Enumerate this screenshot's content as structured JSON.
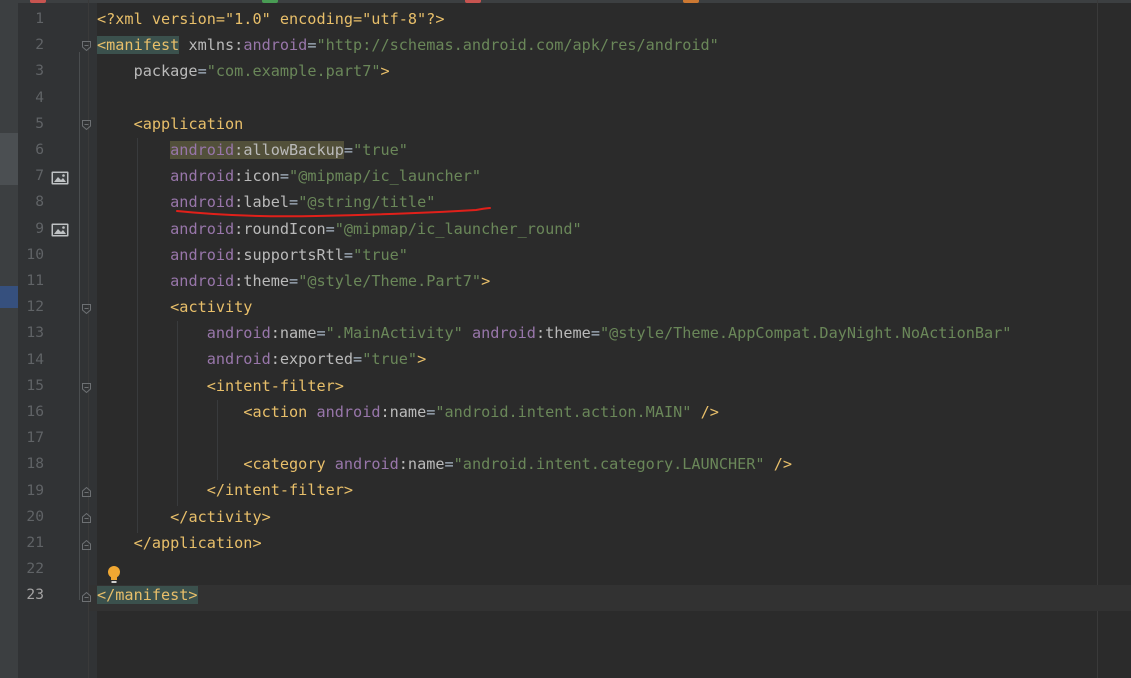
{
  "editor": {
    "file_language": "xml",
    "current_line": 23,
    "lines": [
      {
        "n": "1",
        "segs": [
          {
            "c": "pi",
            "t": "<?xml version=\"1.0\" encoding=\"utf-8\"?>"
          }
        ]
      },
      {
        "n": "2",
        "segs": [
          {
            "c": "tg hl",
            "t": "<manifest"
          },
          {
            "c": "at",
            "t": " xmlns:"
          },
          {
            "c": "ns",
            "t": "android"
          },
          {
            "c": "tx",
            "t": "="
          },
          {
            "c": "val",
            "t": "\"http://schemas.android.com/apk/res/android\""
          }
        ]
      },
      {
        "n": "3",
        "segs": [
          {
            "c": "at",
            "t": "    package"
          },
          {
            "c": "tx",
            "t": "="
          },
          {
            "c": "val",
            "t": "\"com.example.part7\""
          },
          {
            "c": "tg",
            "t": ">"
          }
        ]
      },
      {
        "n": "4",
        "segs": []
      },
      {
        "n": "5",
        "segs": [
          {
            "c": "tx",
            "t": "    "
          },
          {
            "c": "tg",
            "t": "<application"
          }
        ]
      },
      {
        "n": "6",
        "segs": [
          {
            "c": "tx",
            "t": "        "
          },
          {
            "c": "ns warn",
            "t": "android"
          },
          {
            "c": "at warn",
            "t": ":allowBackup"
          },
          {
            "c": "tx",
            "t": "="
          },
          {
            "c": "val",
            "t": "\"true\""
          }
        ]
      },
      {
        "n": "7",
        "segs": [
          {
            "c": "tx",
            "t": "        "
          },
          {
            "c": "ns",
            "t": "android"
          },
          {
            "c": "at",
            "t": ":icon"
          },
          {
            "c": "tx",
            "t": "="
          },
          {
            "c": "val",
            "t": "\"@mipmap/ic_launcher\""
          }
        ]
      },
      {
        "n": "8",
        "segs": [
          {
            "c": "tx",
            "t": "        "
          },
          {
            "c": "ns",
            "t": "android"
          },
          {
            "c": "at",
            "t": ":label"
          },
          {
            "c": "tx",
            "t": "="
          },
          {
            "c": "val",
            "t": "\"@string/title\""
          }
        ]
      },
      {
        "n": "9",
        "segs": [
          {
            "c": "tx",
            "t": "        "
          },
          {
            "c": "ns",
            "t": "android"
          },
          {
            "c": "at",
            "t": ":roundIcon"
          },
          {
            "c": "tx",
            "t": "="
          },
          {
            "c": "val",
            "t": "\"@mipmap/ic_launcher_round\""
          }
        ]
      },
      {
        "n": "10",
        "segs": [
          {
            "c": "tx",
            "t": "        "
          },
          {
            "c": "ns",
            "t": "android"
          },
          {
            "c": "at",
            "t": ":supportsRtl"
          },
          {
            "c": "tx",
            "t": "="
          },
          {
            "c": "val",
            "t": "\"true\""
          }
        ]
      },
      {
        "n": "11",
        "segs": [
          {
            "c": "tx",
            "t": "        "
          },
          {
            "c": "ns",
            "t": "android"
          },
          {
            "c": "at",
            "t": ":theme"
          },
          {
            "c": "tx",
            "t": "="
          },
          {
            "c": "val",
            "t": "\"@style/Theme.Part7\""
          },
          {
            "c": "tg",
            "t": ">"
          }
        ]
      },
      {
        "n": "12",
        "segs": [
          {
            "c": "tx",
            "t": "        "
          },
          {
            "c": "tg",
            "t": "<activity"
          }
        ]
      },
      {
        "n": "13",
        "segs": [
          {
            "c": "tx",
            "t": "            "
          },
          {
            "c": "ns",
            "t": "android"
          },
          {
            "c": "at",
            "t": ":name"
          },
          {
            "c": "tx",
            "t": "="
          },
          {
            "c": "val",
            "t": "\".MainActivity\""
          },
          {
            "c": "tx",
            "t": " "
          },
          {
            "c": "ns",
            "t": "android"
          },
          {
            "c": "at",
            "t": ":theme"
          },
          {
            "c": "tx",
            "t": "="
          },
          {
            "c": "val",
            "t": "\"@style/Theme.AppCompat.DayNight.NoActionBar\""
          }
        ]
      },
      {
        "n": "14",
        "segs": [
          {
            "c": "tx",
            "t": "            "
          },
          {
            "c": "ns",
            "t": "android"
          },
          {
            "c": "at",
            "t": ":exported"
          },
          {
            "c": "tx",
            "t": "="
          },
          {
            "c": "val",
            "t": "\"true\""
          },
          {
            "c": "tg",
            "t": ">"
          }
        ]
      },
      {
        "n": "15",
        "segs": [
          {
            "c": "tx",
            "t": "            "
          },
          {
            "c": "tg",
            "t": "<intent-filter>"
          }
        ]
      },
      {
        "n": "16",
        "segs": [
          {
            "c": "tx",
            "t": "                "
          },
          {
            "c": "tg",
            "t": "<action"
          },
          {
            "c": "tx",
            "t": " "
          },
          {
            "c": "ns",
            "t": "android"
          },
          {
            "c": "at",
            "t": ":name"
          },
          {
            "c": "tx",
            "t": "="
          },
          {
            "c": "val",
            "t": "\"android.intent.action.MAIN\""
          },
          {
            "c": "tx",
            "t": " "
          },
          {
            "c": "tg",
            "t": "/>"
          }
        ]
      },
      {
        "n": "17",
        "segs": []
      },
      {
        "n": "18",
        "segs": [
          {
            "c": "tx",
            "t": "                "
          },
          {
            "c": "tg",
            "t": "<category"
          },
          {
            "c": "tx",
            "t": " "
          },
          {
            "c": "ns",
            "t": "android"
          },
          {
            "c": "at",
            "t": ":name"
          },
          {
            "c": "tx",
            "t": "="
          },
          {
            "c": "val",
            "t": "\"android.intent.category.LAUNCHER\""
          },
          {
            "c": "tx",
            "t": " "
          },
          {
            "c": "tg",
            "t": "/>"
          }
        ]
      },
      {
        "n": "19",
        "segs": [
          {
            "c": "tx",
            "t": "            "
          },
          {
            "c": "tg",
            "t": "</intent-filter>"
          }
        ]
      },
      {
        "n": "20",
        "segs": [
          {
            "c": "tx",
            "t": "        "
          },
          {
            "c": "tg",
            "t": "</activity>"
          }
        ]
      },
      {
        "n": "21",
        "segs": [
          {
            "c": "tx",
            "t": "    "
          },
          {
            "c": "tg",
            "t": "</application>"
          }
        ]
      },
      {
        "n": "22",
        "segs": []
      },
      {
        "n": "23",
        "segs": [
          {
            "c": "tg hl",
            "t": "</manifest>"
          }
        ]
      }
    ]
  },
  "colors": {
    "background": "#2b2b2b",
    "tag": "#e8bf6a",
    "namespace": "#9876aa",
    "attribute": "#bababa",
    "value": "#6a8759",
    "annotation_underline": "#e0201a"
  },
  "icons": {
    "fold": "fold-marker-icon",
    "resource_preview": "image-preview-icon",
    "intention": "lightbulb-icon"
  }
}
